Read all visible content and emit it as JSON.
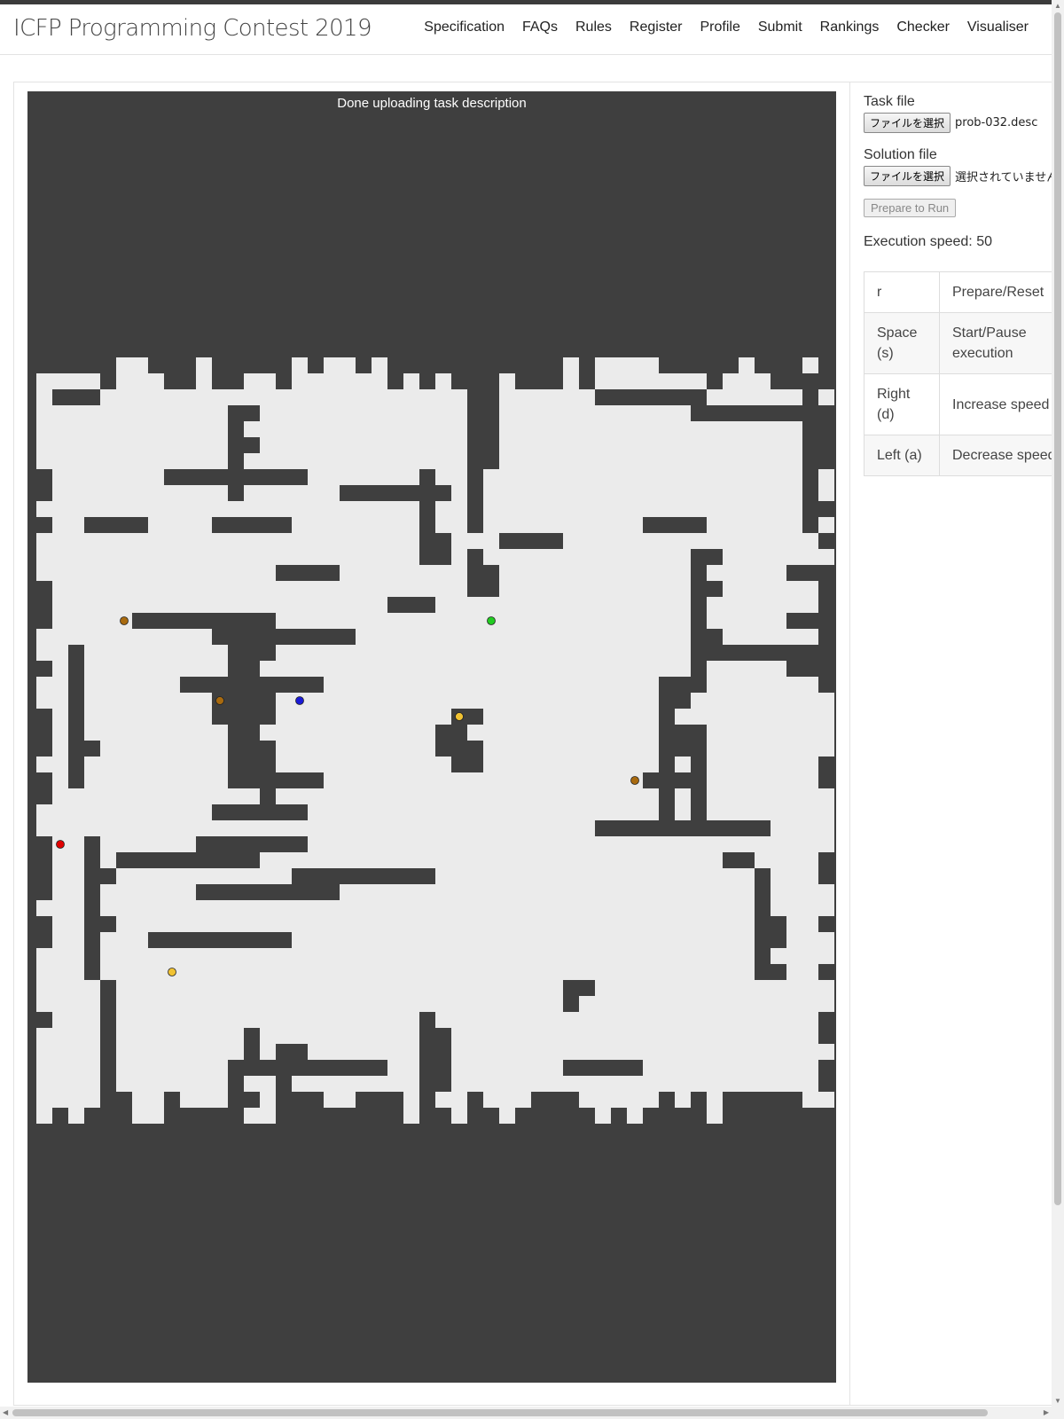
{
  "brand": "ICFP Programming Contest 2019",
  "nav": [
    "Specification",
    "FAQs",
    "Rules",
    "Register",
    "Profile",
    "Submit",
    "Rankings",
    "Checker",
    "Visualiser"
  ],
  "canvas": {
    "status": "Done uploading task description"
  },
  "side": {
    "task_label": "Task file",
    "task_button": "ファイルを選択",
    "task_filename": "prob-032.desc",
    "solution_label": "Solution file",
    "solution_button": "ファイルを選択",
    "solution_filename": "選択されていません",
    "prepare_button": "Prepare to Run",
    "speed_text": "Execution speed: 50",
    "keys": [
      {
        "key": "r",
        "action": "Prepare/Reset"
      },
      {
        "key": "Space (s)",
        "action": "Start/Pause execution"
      },
      {
        "key": "Right (d)",
        "action": "Increase speed"
      },
      {
        "key": "Left (a)",
        "action": "Decrease speed"
      }
    ]
  },
  "map": {
    "grid": [
      "000000000000000000000000000000000000000000000000000000000000000000000000000000000000000000000000000000000000000000000000000000000000",
      "000000000000000000000000000000000000000000000000000000000000000000000000000000000000000000000000000000000000000000000000000000000000",
      "000000000000000000000000000000000000000000000000000000000000000000000000000000000000000000000000000000000000000000000000000000000000",
      "000000000000000000000000000000000000000000000000000000000000000000000000000000000000000000000000000000000000000000000000000000000000",
      "000000000000000000000000000000000000000000000000000000000000000000000000000000000000000000000000000000000000000000000000000000000000",
      "000000000000000000000000000000000000000000000000000000000000000000000000000000000000000000000000000000000000000000000000000000000000",
      "000000000000000000000000000000000000000000000000000000000000000000000000000000000000000000000000000000000000000000000000000000000000",
      "000000000000000000000000000000000000000000000000000000000000000000000000000000000000000000000000000000000000000000000000000000000000",
      "000000000000000000000000000000000000000000000000000000000000000000000000000000000000000000000000000000000000000000000000000000000000",
      "000000000000000000000000000000000000000000000000000000000000000000000000000000000000000000000000000000000000000000000000000000000000",
      "000000000000000000000000000000000000000000000000000000000000000000000000000000000000000000000000000000000000000000000000000000000000",
      "000000000000000000000000000000000000000000000000000000000000000000000000000000000000000000000000000000000000000000000000000000000000",
      "000000000000000000000000000000000000000000000000000000000000000000000000000000000000000000000000000000000000000000000000000000000000",
      "000000000000000000000000000000000000000000000000000000000000000000000000000000000000000000000000000000000000000000000000000000000000",
      "000000000000000000000000000000000000000000000000000000000000000000000000000000000000000000000000000000000000000000000000000000000000",
      "000000000000000000000000000000000000000000000000000000000000000000000000000000000000000000000000000000000000000000000000000000000000",
      "000000000000000000000000000000000000000000000000000000000000000000000000000000000000000000000000000000000000000000000000000000000000",
      "000000000000000000000000000000000000000000000000000000000000000000000000000000000000000000000000000000000000000000000000000000000000",
      "000000000000000000000000000000000000000000000000000000000000000000000000000000000000000000000000000000000000000000000000000000000000",
      "000000000000000000000000000000000000000000000000000000000000000000000000000000000000000000000000000000000000000000000000000000000000",
      "000000000000000000000000000000000000000000000000000000000000000000000000000000000000000000000000000000000000000000000000000000000000",
      "000000000000000000000000000000000000000000000000000000000000000000000000000000000000000000000000000000000000000000000000000000000000",
      "000000000000000000000000000000000000000000000000000000000000000000000000000000000000000000000000000000000000000000000000000000000000",
      "000000000000000000000000000000000000000000000000000000000000000000000000000000000000000000000000000000000000000000000000000000000000",
      "000000000000000000000000000000000000000000000000000000000000000000000000000000000000000000000000000000000000000000000000000000000000",
      "000000000000000000000000000000000000000000000000000000000000000000000000000000000000000000000000000000000000000000000000000000000000",
      "000000000000000000000000000000000000000000000000000000000000000000000000000000000000000000000000000000000000000000000000000000000000",
      "000000000000000000000000000000000000000000000000000000000000000000000000000000000000000000000000000000000000000000000000000000000000",
      "000000000000000000000000000000000000000000000000000000000000000000000000000000000000000000000000000000000000000000000000000000000000",
      "000000000000000000000000000000000000000000000000000000000000000000000000000000000000000000000000000000000000000000000000000000000000",
      "000000000000000000000000000000000000000000000000000000000000000000000000000000000000000000000000000000000000000000000000000000000000",
      "000000000000000000000000000000000000000000000000000000000000000000000000000000000000000000000000000000000000000000000000000000000000",
      "000000000000000000000000000000000000000000000000000000000000000000000000000000000000000000000000000000000000000000000000000000000000",
      "000000000000000000000000000000000000000000000000000000000000000000000000000000000000000000000000000000000000000000000000000000000000",
      "000000000000000000000000000000000000000000000000000000000000000000000000000000000000000000000000000000000000000000000000000000000000",
      "000000000000000000000000000000000000000000000000000000000000000000000000000000000000000000000000000000000000000000000000000000000000",
      "000000000000000000000000000000000000000000000000000000000000000000000000000000000000000000000000000000000000000000000000000000000000",
      "000000000000000000000000000000000000000000000000000000000000000000000000000000000000000000000000000000000000000000000000000000000000",
      "000000000000000000000000000000000000000000000000000000000000000000000000000000000000000000000000000000000000000000000000000000000000",
      "000000000000000000000000000000000000000000000000000000000000000000000000000000000000000000000000000000000000000000000000000000000000",
      "000000000000000000000000000000000000000000000000000000000000000000000000000000000000000000000000000000000000000000000000000000000000",
      "000000000000011000000000000000000000000000000000000000000000000000000000000000000000000000000000000000000000000000000000000000000000",
      "000000000000111000000000000000000000000000000000000000000000000000000000000000000000000000000000000000000000000000000000000000000000",
      "000000000001111000000000000000000000000000000000000000000000000000000000000000000000000000000000000000000000000000000000000000000000",
      "000000000011111000000000000000000000000000000000000000000000000000000000000000000000000000000000000000000000000000000000000000000000",
      "000000000111111000000000000000000000000000000000000000000000000000000000000000000000000000000000000000000000000000000000000000000000",
      "000000001111111000000000000000000000000000000000000000000000000000000000000000000000000000000000000000000000000000000000000000000000",
      "000000011111111000000000000000000000000000000000000000000000000000000000000000000000000000000000000000000000000000000000000000000000",
      "000000111111111000000000000000000000000000000000000000000000000000000000000000000000000000000000000000000000000000000000000000000000",
      "000001111111111000000000000000000000000000000000000000000000000000000000000000000000000000000000000000000000000000000000000000000000",
      "000011111111111000000000000000000000000000000000000000000000000000000000000000000000000000000000000000000000000000000000000000000000",
      "000111111111111000000000000000000000000000000000000000000000000000000000000000000000000000000000000000000000000000000000000000000000",
      "001111111111111000000000000000000000000000000000000000000000000000000000000000000000000000000000000000000000000000000000000000000000",
      "011111111111111000000000000000000000000000000000000000000000000000000000000000000000000000000000000000000000000000000000000000000000",
      "111111111111111000000000000000000000000000000000000000000000000000000000000000000000000000000000000000000000000000000000000000000000"
    ],
    "grid_note_ignored": true,
    "cells": 50,
    "rows": 48,
    "robot": {
      "x": 16,
      "y": 26
    },
    "boosters": [
      {
        "x": 5,
        "y": 31,
        "color": "#a86a0f"
      },
      {
        "x": 11,
        "y": 26,
        "color": "#a86a0f"
      },
      {
        "x": 37,
        "y": 21,
        "color": "#a86a0f"
      },
      {
        "x": 28,
        "y": 31,
        "color": "#22cc22"
      },
      {
        "x": 26,
        "y": 25,
        "color": "#f1c232"
      },
      {
        "x": 8,
        "y": 9,
        "color": "#f1c232"
      },
      {
        "x": 1,
        "y": 17,
        "color": "#e00000"
      }
    ]
  },
  "colors": {
    "floor": "#ebebeb",
    "wall": "#3f3f3f",
    "robot": "#1a1ad6"
  }
}
